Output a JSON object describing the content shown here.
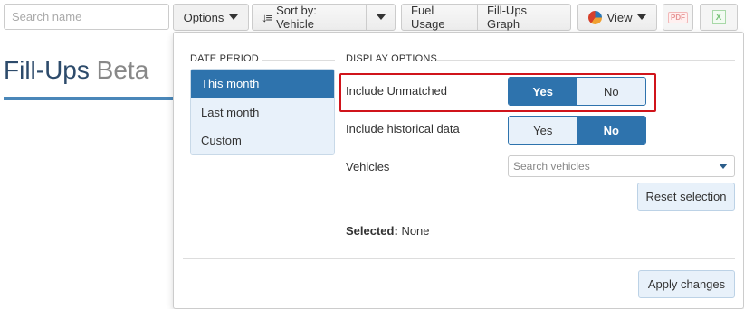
{
  "toolbar": {
    "search_placeholder": "Search name",
    "options_label": "Options",
    "sort_label": "Sort by: Vehicle",
    "fuel_usage_label": "Fuel Usage",
    "fillups_graph_label": "Fill-Ups Graph",
    "view_label": "View",
    "pdf_label": "PDF",
    "xls_label": "X"
  },
  "page": {
    "title": "Fill-Ups",
    "title_suffix": "Beta"
  },
  "panel": {
    "date_period_heading": "DATE PERIOD",
    "display_options_heading": "DISPLAY OPTIONS",
    "periods": [
      {
        "label": "This month",
        "active": true
      },
      {
        "label": "Last month",
        "active": false
      },
      {
        "label": "Custom",
        "active": false
      }
    ],
    "include_unmatched": {
      "label": "Include Unmatched",
      "yes": "Yes",
      "no": "No",
      "selected": "Yes"
    },
    "include_historical": {
      "label": "Include historical data",
      "yes": "Yes",
      "no": "No",
      "selected": "No"
    },
    "vehicles": {
      "label": "Vehicles",
      "placeholder": "Search vehicles"
    },
    "reset_label": "Reset selection",
    "selected_prefix": "Selected:",
    "selected_value": "None",
    "apply_label": "Apply changes"
  },
  "colors": {
    "accent": "#2e73ad",
    "highlight": "#d0141b",
    "title": "#2d4b6b"
  }
}
